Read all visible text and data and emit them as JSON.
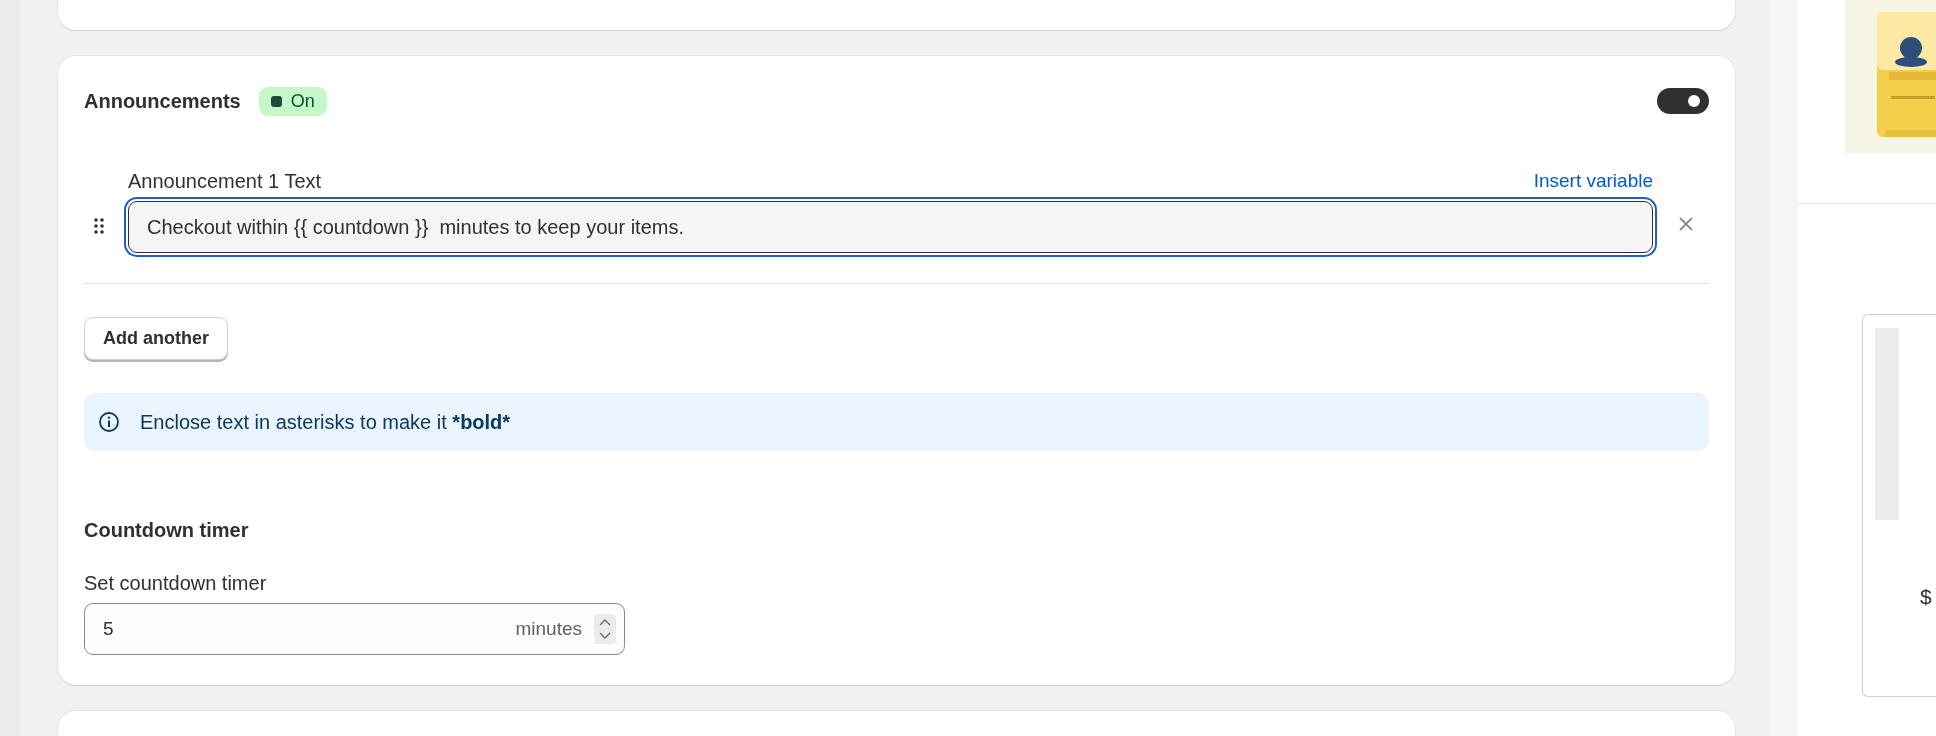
{
  "announcements": {
    "title": "Announcements",
    "status_badge": {
      "label": "On",
      "on": true
    },
    "enabled": true,
    "items": [
      {
        "label": "Announcement 1 Text",
        "action": "Insert variable",
        "value": "Checkout within {{ countdown }}  minutes to keep your items.",
        "focused": true
      }
    ],
    "add_button": "Add another",
    "info": {
      "text": "Enclose text in asterisks to make it ",
      "emphasis": "*bold*"
    },
    "countdown": {
      "title": "Countdown timer",
      "label": "Set countdown timer",
      "value": "5",
      "suffix": "minutes"
    }
  },
  "preview": {
    "price_symbol": "$"
  }
}
